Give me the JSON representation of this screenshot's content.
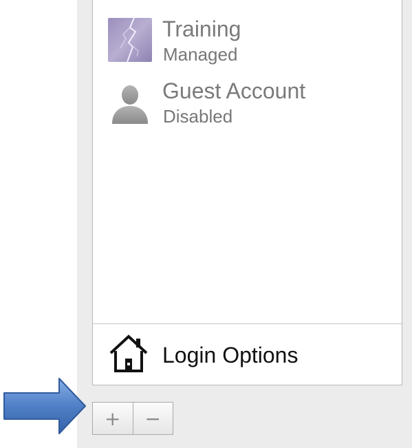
{
  "users": [
    {
      "name": "Training",
      "status": "Managed",
      "avatar_icon": "lightning-icon"
    },
    {
      "name": "Guest Account",
      "status": "Disabled",
      "avatar_icon": "person-silhouette-icon"
    }
  ],
  "login_options": {
    "label": "Login Options",
    "icon": "home-icon"
  },
  "buttons": {
    "add_label": "+",
    "remove_label": "−"
  },
  "colors": {
    "pane_background": "#ececec",
    "list_background": "#ffffff",
    "secondary_text": "#7a7a7a",
    "arrow_fill": "#4f7fc6"
  }
}
